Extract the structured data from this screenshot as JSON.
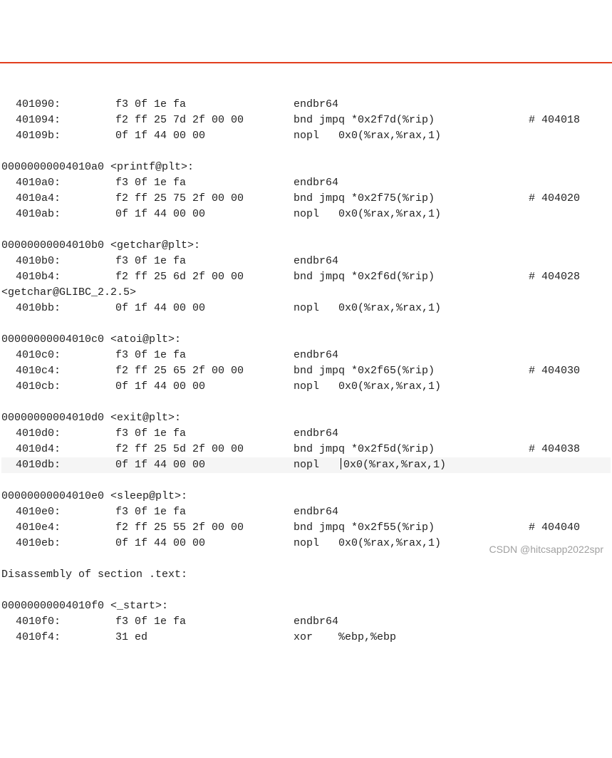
{
  "rows": [
    {
      "type": "inst",
      "addr": "401090:",
      "bytes": "f3 0f 1e fa",
      "asm": "endbr64",
      "cmt": ""
    },
    {
      "type": "inst",
      "addr": "401094:",
      "bytes": "f2 ff 25 7d 2f 00 00",
      "asm": "bnd jmpq *0x2f7d(%rip)",
      "cmt": "# 404018"
    },
    {
      "type": "inst",
      "addr": "40109b:",
      "bytes": "0f 1f 44 00 00",
      "asm": "nopl   0x0(%rax,%rax,1)",
      "cmt": ""
    },
    {
      "type": "blank"
    },
    {
      "type": "header",
      "text": "00000000004010a0 <printf@plt>:"
    },
    {
      "type": "inst",
      "addr": "4010a0:",
      "bytes": "f3 0f 1e fa",
      "asm": "endbr64",
      "cmt": ""
    },
    {
      "type": "inst",
      "addr": "4010a4:",
      "bytes": "f2 ff 25 75 2f 00 00",
      "asm": "bnd jmpq *0x2f75(%rip)",
      "cmt": "# 404020"
    },
    {
      "type": "inst",
      "addr": "4010ab:",
      "bytes": "0f 1f 44 00 00",
      "asm": "nopl   0x0(%rax,%rax,1)",
      "cmt": ""
    },
    {
      "type": "blank"
    },
    {
      "type": "header",
      "text": "00000000004010b0 <getchar@plt>:"
    },
    {
      "type": "inst",
      "addr": "4010b0:",
      "bytes": "f3 0f 1e fa",
      "asm": "endbr64",
      "cmt": ""
    },
    {
      "type": "inst",
      "addr": "4010b4:",
      "bytes": "f2 ff 25 6d 2f 00 00",
      "asm": "bnd jmpq *0x2f6d(%rip)",
      "cmt": "# 404028"
    },
    {
      "type": "plain",
      "text": "<getchar@GLIBC_2.2.5>"
    },
    {
      "type": "inst",
      "addr": "4010bb:",
      "bytes": "0f 1f 44 00 00",
      "asm": "nopl   0x0(%rax,%rax,1)",
      "cmt": ""
    },
    {
      "type": "blank"
    },
    {
      "type": "header",
      "text": "00000000004010c0 <atoi@plt>:"
    },
    {
      "type": "inst",
      "addr": "4010c0:",
      "bytes": "f3 0f 1e fa",
      "asm": "endbr64",
      "cmt": ""
    },
    {
      "type": "inst",
      "addr": "4010c4:",
      "bytes": "f2 ff 25 65 2f 00 00",
      "asm": "bnd jmpq *0x2f65(%rip)",
      "cmt": "# 404030"
    },
    {
      "type": "inst",
      "addr": "4010cb:",
      "bytes": "0f 1f 44 00 00",
      "asm": "nopl   0x0(%rax,%rax,1)",
      "cmt": ""
    },
    {
      "type": "blank"
    },
    {
      "type": "header",
      "text": "00000000004010d0 <exit@plt>:"
    },
    {
      "type": "inst",
      "addr": "4010d0:",
      "bytes": "f3 0f 1e fa",
      "asm": "endbr64",
      "cmt": ""
    },
    {
      "type": "inst",
      "addr": "4010d4:",
      "bytes": "f2 ff 25 5d 2f 00 00",
      "asm": "bnd jmpq *0x2f5d(%rip)",
      "cmt": "# 404038"
    },
    {
      "type": "inst",
      "addr": "4010db:",
      "bytes": "0f 1f 44 00 00",
      "asm": "nopl   0x0(%rax,%rax,1)",
      "cmt": "",
      "hl": true,
      "cursor": true
    },
    {
      "type": "blank"
    },
    {
      "type": "header",
      "text": "00000000004010e0 <sleep@plt>:"
    },
    {
      "type": "inst",
      "addr": "4010e0:",
      "bytes": "f3 0f 1e fa",
      "asm": "endbr64",
      "cmt": ""
    },
    {
      "type": "inst",
      "addr": "4010e4:",
      "bytes": "f2 ff 25 55 2f 00 00",
      "asm": "bnd jmpq *0x2f55(%rip)",
      "cmt": "# 404040"
    },
    {
      "type": "inst",
      "addr": "4010eb:",
      "bytes": "0f 1f 44 00 00",
      "asm": "nopl   0x0(%rax,%rax,1)",
      "cmt": ""
    },
    {
      "type": "blank"
    },
    {
      "type": "plain",
      "text": "Disassembly of section .text:"
    },
    {
      "type": "blank"
    },
    {
      "type": "header",
      "text": "00000000004010f0 <_start>:"
    },
    {
      "type": "inst",
      "addr": "4010f0:",
      "bytes": "f3 0f 1e fa",
      "asm": "endbr64",
      "cmt": ""
    },
    {
      "type": "inst",
      "addr": "4010f4:",
      "bytes": "31 ed",
      "asm": "xor    %ebp,%ebp",
      "cmt": ""
    }
  ],
  "watermark": "CSDN @hitcsapp2022spr"
}
